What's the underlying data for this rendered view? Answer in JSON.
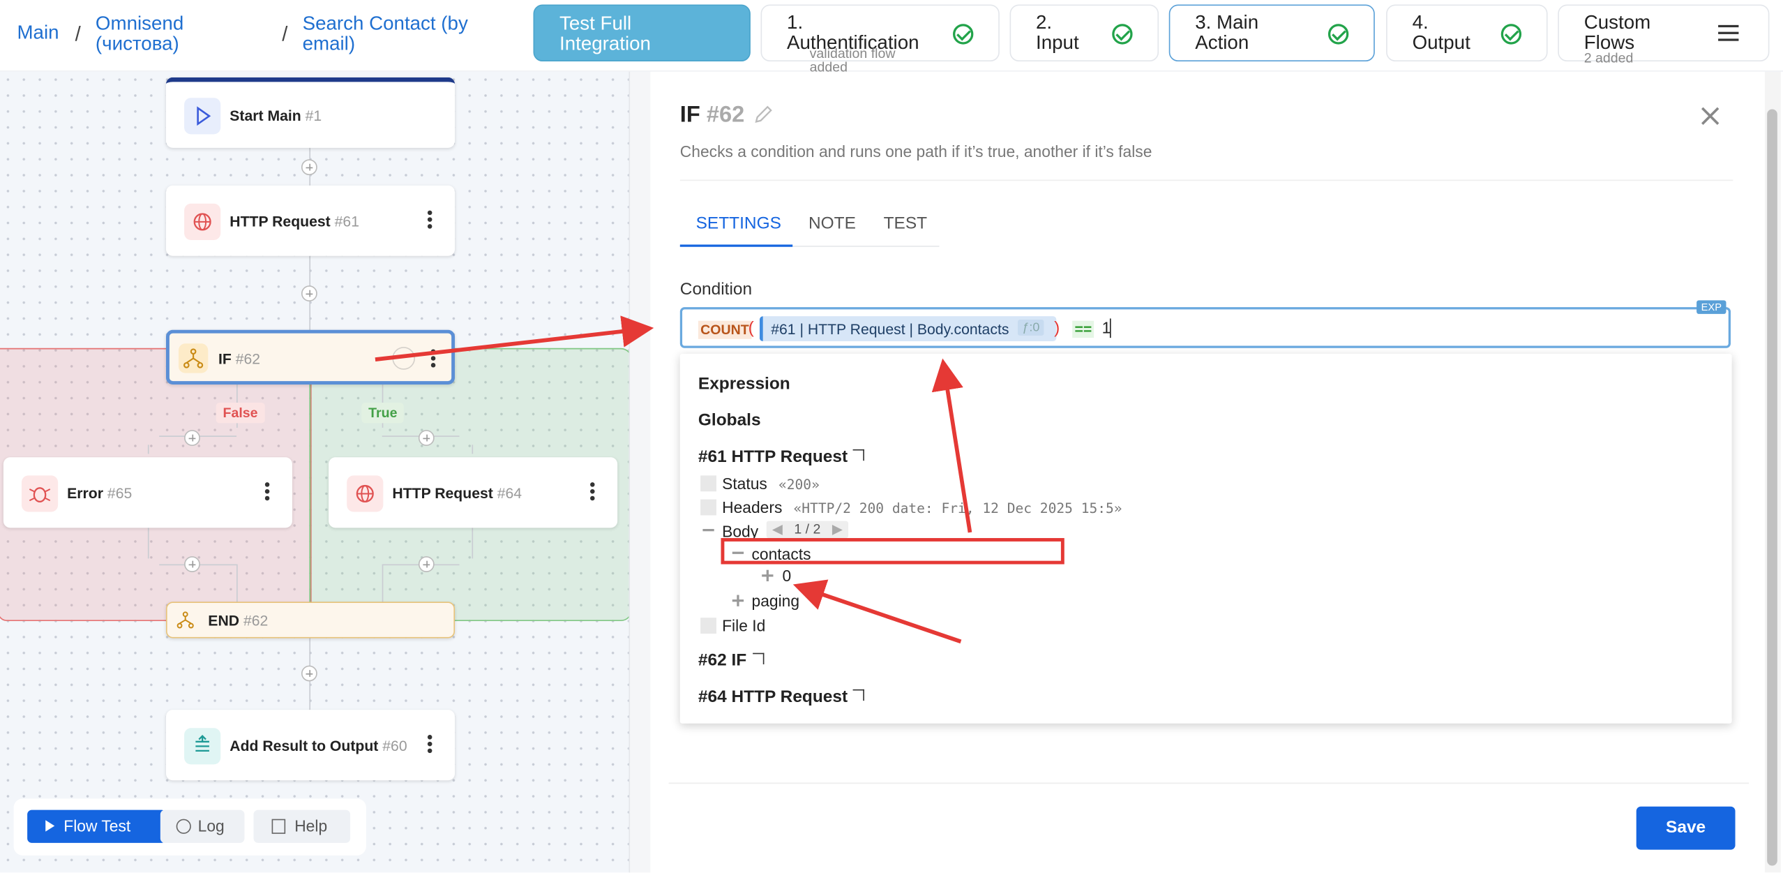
{
  "breadcrumb": {
    "main": "Main",
    "omnisend": "Omnisend",
    "omnisend2": "(чистова)",
    "search": "Search Contact (by",
    "search2": "email)"
  },
  "header": {
    "test_button_1": "Test Full",
    "test_button_2": "Integration",
    "steps": [
      {
        "num": "1.",
        "label": "Authentification",
        "sub1": "validation flow",
        "sub2": "added"
      },
      {
        "num": "2.",
        "label": "Input"
      },
      {
        "num": "3. Main",
        "label": "Action"
      },
      {
        "num": "4.",
        "label": "Output"
      },
      {
        "num": "Custom",
        "label": "Flows",
        "sub1": "2 added"
      }
    ]
  },
  "flow": {
    "start": {
      "name": "Start Main",
      "id": "#1"
    },
    "http61": {
      "name": "HTTP Request",
      "id": "#61"
    },
    "if62": {
      "name": "IF",
      "id": "#62"
    },
    "false_label": "False",
    "true_label": "True",
    "error65": {
      "name": "Error",
      "id": "#65"
    },
    "http64": {
      "name": "HTTP Request",
      "id": "#64"
    },
    "end62": {
      "name": "END",
      "id": "#62"
    },
    "add60": {
      "name": "Add Result to Output",
      "id": "#60"
    }
  },
  "toolbar": {
    "flow_test": "Flow Test",
    "log": "Log",
    "help": "Help"
  },
  "panel": {
    "title": "IF",
    "id": "#62",
    "description": "Checks a condition and runs one path if it’s true, another if it’s false",
    "tabs": [
      "SETTINGS",
      "NOTE",
      "TEST"
    ],
    "condition_label": "Condition",
    "exp_badge": "EXP",
    "expression": {
      "func": "COUNT",
      "paren_open": "(",
      "token": "#61 | HTTP Request | Body.contacts",
      "token_meta": "ƒ:0",
      "paren_close": ")",
      "op": "==",
      "value": "1"
    },
    "dropdown": {
      "expression": "Expression",
      "globals": "Globals",
      "http61": "#61 HTTP Request",
      "status": "Status",
      "status_val": "«200»",
      "headers": "Headers",
      "headers_val": "«HTTP/2 200 date: Fri, 12 Dec 2025 15:5»",
      "body": "Body",
      "body_pager": "1 / 2",
      "contacts": "contacts",
      "zero": "0",
      "paging": "paging",
      "file_id": "File Id",
      "if62": "#62 IF",
      "http64": "#64 HTTP Request"
    },
    "save": "Save"
  },
  "colors": {
    "accent": "#1565e0",
    "annotation": "#e53935",
    "true": "#4caf50",
    "false": "#e57373"
  }
}
